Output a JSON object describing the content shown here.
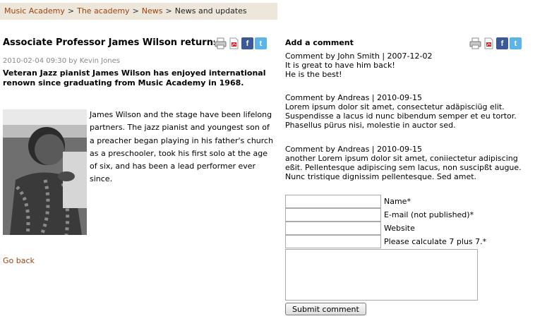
{
  "breadcrumb": {
    "items": [
      "Music Academy",
      "The academy",
      "News"
    ],
    "current": "News and updates",
    "separator": ">"
  },
  "article": {
    "title": "Associate Professor James Wilson returns",
    "meta": "2010-02-04 09:30 by Kevin Jones",
    "lead": "Veteran Jazz pianist James Wilson has enjoyed international renown since graduating from Music Academy in 1968.",
    "body": "James Wilson and the stage have been lifelong partners. The jazz pianist and youngest son of a preacher began playing in his father's church as a preschooler, took his first solo at the age of six, and has been a lead performer ever since.",
    "go_back": "Go back"
  },
  "share_icons": [
    "print-icon",
    "pdf-icon",
    "facebook-icon",
    "twitter-icon"
  ],
  "share_glyphs": {
    "facebook": "f",
    "twitter": "t"
  },
  "comments_section": {
    "title": "Add a comment",
    "comments": [
      {
        "header": "Comment by John Smith | 2007-12-02",
        "lines": [
          "It is great to have him back!",
          "He is the best!"
        ]
      },
      {
        "header": "Comment by Andreas | 2010-09-15",
        "lines": [
          "Lorem ipsum dolor sit amet, consectetur adäpisciüg elit.",
          "Suspendisse a lacus id nunc bibendum semper et eu tortor.",
          "Phasellus pürus nisi, molestie in auctor sed."
        ]
      },
      {
        "header": "Comment by Andreas | 2010-09-15",
        "lines": [
          "another Lorem ipsum dolor sit amet, coniiectetur adipiscing",
          "eßit. Pellentesque adipiscing sem lacus, non suscipßt augue.",
          "Nunc tristique dignissim pellentesque. Sed amet."
        ]
      }
    ]
  },
  "form": {
    "name_label": "Name*",
    "email_label": "E-mail (not published)*",
    "website_label": "Website",
    "captcha_label": "Please calculate 7 plus 7.*",
    "submit_label": "Submit comment"
  },
  "colors": {
    "link": "#a0420e",
    "breadcrumb_bg": "#ede6da",
    "facebook": "#3b5998",
    "twitter": "#5bb5e8"
  }
}
